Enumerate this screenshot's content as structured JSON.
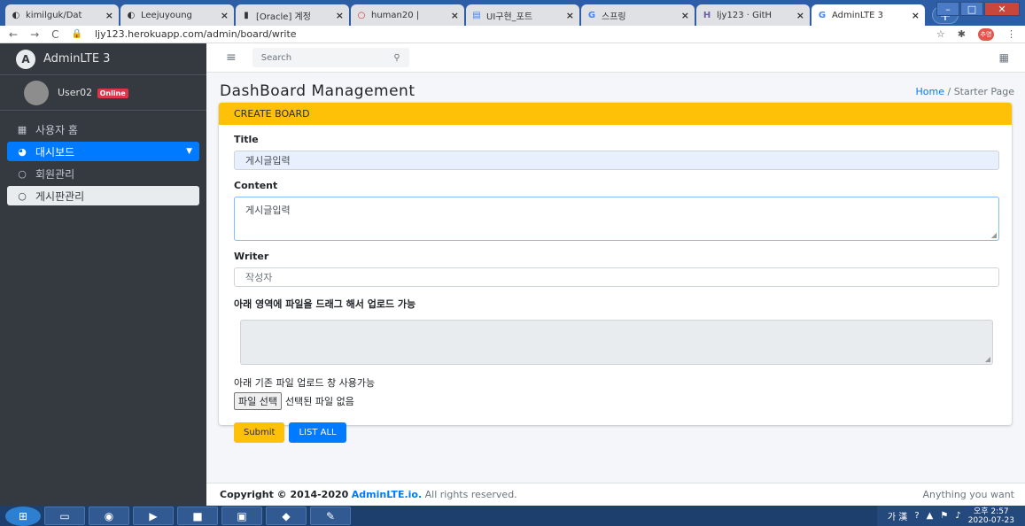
{
  "browser": {
    "tabs": [
      {
        "title": "kimilguk/Dat",
        "icon": "github-icon",
        "glyph": "◐"
      },
      {
        "title": "Leejuyoung",
        "icon": "github-icon",
        "glyph": "◐"
      },
      {
        "title": "[Oracle] 계정",
        "icon": "blog-icon",
        "glyph": "▮"
      },
      {
        "title": "human20 |",
        "icon": "circle-icon",
        "glyph": "○"
      },
      {
        "title": "UI구현_포트",
        "icon": "docs-icon",
        "glyph": "▤"
      },
      {
        "title": "스프링",
        "icon": "google-icon",
        "glyph": "G"
      },
      {
        "title": "ljy123 · GitH",
        "icon": "heroku-icon",
        "glyph": "H"
      },
      {
        "title": "AdminLTE 3",
        "icon": "google-icon",
        "glyph": "G"
      }
    ],
    "url": "ljy123.herokuapp.com/admin/board/write",
    "profile_label": "추영"
  },
  "sidebar": {
    "brand": "AdminLTE 3",
    "user": "User02",
    "status_badge": "Online",
    "items": [
      {
        "label": "사용자 홈"
      },
      {
        "label": "대시보드"
      },
      {
        "label": "회원관리"
      },
      {
        "label": "게시판관리"
      }
    ]
  },
  "topnav": {
    "search_placeholder": "Search"
  },
  "page": {
    "title": "DashBoard Management",
    "breadcrumb_home": "Home",
    "breadcrumb_sep": "/",
    "breadcrumb_current": "Starter Page"
  },
  "form": {
    "header": "CREATE BOARD",
    "title_label": "Title",
    "title_value": "게시글입력",
    "content_label": "Content",
    "content_value": "게시글입력",
    "writer_label": "Writer",
    "writer_placeholder": "작성자",
    "dropzone_label": "아래 영역에 파일을 드래그 해서 업로드 가능",
    "file_label": "아래 기존 파일 업로드 창 사용가능",
    "file_button": "파일 선택",
    "file_status": "선택된 파일 없음",
    "submit": "Submit",
    "list_all": "LIST ALL"
  },
  "footer": {
    "copyright_prefix": "Copyright © 2014-2020",
    "brand_link": "AdminLTE.io.",
    "rights": "All rights reserved.",
    "right_text": "Anything you want"
  },
  "taskbar": {
    "tray_text": "가 漢",
    "time": "오후 2:57",
    "date": "2020-07-23"
  }
}
